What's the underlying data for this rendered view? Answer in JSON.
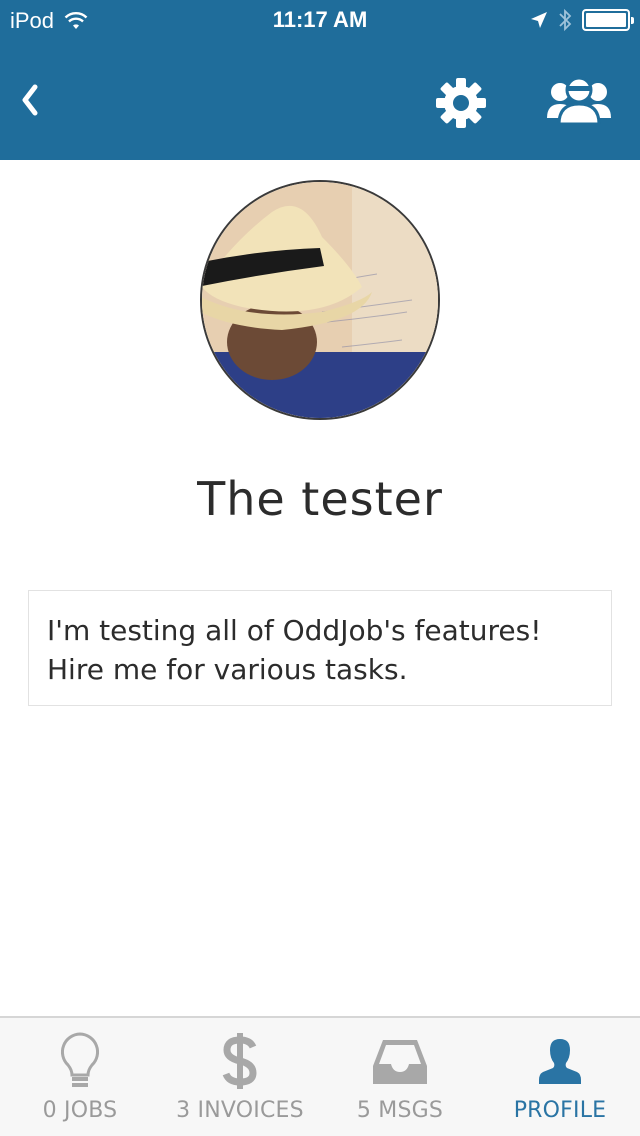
{
  "status_bar": {
    "carrier": "iPod",
    "time": "11:17 AM"
  },
  "header": {
    "back_glyph": "❮",
    "icons": [
      "back-chevron-icon",
      "gear-icon",
      "people-group-icon"
    ]
  },
  "profile": {
    "name": "The tester",
    "bio_line1": "I'm testing all of OddJob's features!",
    "bio_line2": "Hire me for various tasks."
  },
  "tabs": [
    {
      "label": "0 JOBS",
      "icon": "lightbulb-icon",
      "active": false
    },
    {
      "label": "3 INVOICES",
      "icon": "dollar-icon",
      "active": false
    },
    {
      "label": "5 MSGS",
      "icon": "inbox-tray-icon",
      "active": false
    },
    {
      "label": "PROFILE",
      "icon": "person-icon",
      "active": true
    }
  ],
  "colors": {
    "header_bg": "#1f6d9b",
    "tab_active": "#2a74a4",
    "tab_inactive": "#9a9a9a"
  }
}
